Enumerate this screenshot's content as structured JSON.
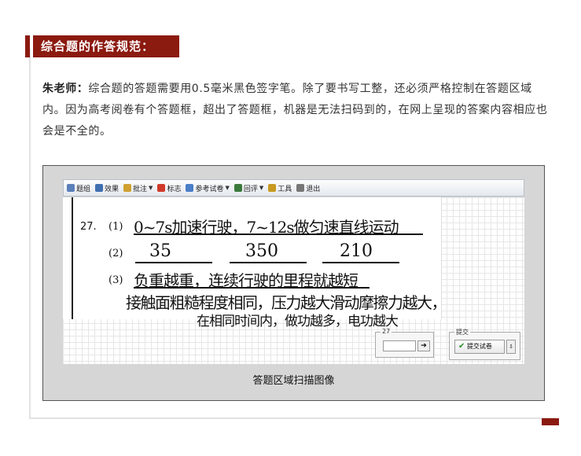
{
  "section_title": "综合题的作答规范：",
  "teacher": {
    "name": "朱老师：",
    "text": "综合题的答题需要用0.5毫米黑色签字笔。除了要书写工整，还必须严格控制在答题区域内。因为高考阅卷有个答题框，超出了答题框，机器是无法扫码到的，在网上呈现的答案内容相应也会是不全的。"
  },
  "toolbar": {
    "items": [
      {
        "label": "题组",
        "icon": "group-icon",
        "color": "#5b7fb8",
        "dropdown": false
      },
      {
        "label": "效果",
        "icon": "effect-icon",
        "color": "#3f6fb0",
        "dropdown": false
      },
      {
        "label": "批注",
        "icon": "pencil-icon",
        "color": "#d0a030",
        "dropdown": true
      },
      {
        "label": "标志",
        "icon": "mark-icon",
        "color": "#d03a2a",
        "dropdown": false
      },
      {
        "label": "参考试卷",
        "icon": "reference-icon",
        "color": "#4a7ec8",
        "dropdown": true
      },
      {
        "label": "回评",
        "icon": "back-icon",
        "color": "#3a7a3a",
        "dropdown": true
      },
      {
        "label": "工具",
        "icon": "tool-icon",
        "color": "#c89a20",
        "dropdown": false
      },
      {
        "label": "退出",
        "icon": "exit-icon",
        "color": "#777777",
        "dropdown": false
      }
    ]
  },
  "answer": {
    "question_number": "27.",
    "line1_num": "(1)",
    "line1_text": "0~7s加速行驶，7~12s做匀速直线运动",
    "line2_num": "(2)",
    "line2_values": [
      "35",
      "350",
      "210"
    ],
    "line3_num": "(3)",
    "line3_text": "负重越重，连续行驶的里程就越短",
    "line4_text": "接触面粗糙程度相同，压力越大滑动摩擦力越大，",
    "line5_text": "在相同时间内，做功越多，电功越大"
  },
  "score_panel": {
    "label": "27",
    "arrow": "➔"
  },
  "submit_panel": {
    "label": "提交",
    "button_label": "提交试卷",
    "check": "✔",
    "extra": "⇩"
  },
  "caption": "答题区域扫描图像"
}
